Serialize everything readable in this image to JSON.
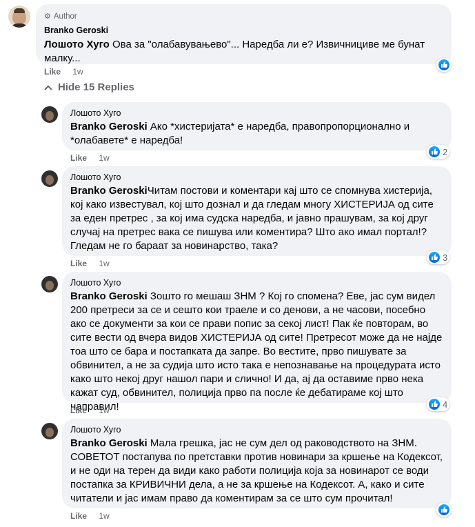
{
  "main_comment": {
    "badge": "Author",
    "name": "Branko Geroski",
    "mention": "Лошото Хуго",
    "text": " Ова за \"олабавувањево\"... Наредба ли е? Извичнициве ме бунат малку...",
    "like": "Like",
    "time": "1w"
  },
  "hide_replies": "Hide 15 Replies",
  "replies": [
    {
      "name": "Лошото Хуго",
      "mention": "Branko Geroski",
      "text": " Ако *хистеријата* е наредба, правопропорционално и *олабавете* е наредба!",
      "like": "Like",
      "time": "1w",
      "reactions": "2"
    },
    {
      "name": "Лошото Хуго",
      "mention": "Branko Geroski",
      "text": "Читам постови и коментари кај што се спомнува хистерија, кој како известувал, кој што дознал и да гледам многу ХИСТЕРИЈА од сите за еден претрес , за кој има судска наредба, и јавно прашувам, за кој друг случај на претрес вака се пишува или коментира? Што ако имал портал!? Гледам не го бараат за новинарство, така?",
      "like": "Like",
      "time": "1w",
      "reactions": "3"
    },
    {
      "name": "Лошото Хуго",
      "mention": "Branko Geroski",
      "text": " Зошто го мешаш ЗНМ ? Кој го спомена? Еве, јас сум видел 200 претреси за се и сешто кои траеле и со денови, а не часови, посебно ако се документи за кои се прави попис за секој лист! Пак ќе повторам, во сите вести од вчера видов ХИСТЕРИЈА од сите! Претресот може да не најде тоа што се бара и постапката да запре. Во вестите, прво пишувате за обвинител, а не за судија што исто така е непознавање на процедурата исто како што некој друг нашол пари и слично! И да, ај да оставиме прво нека кажат суд, обвинител, полиција прво па после ќе дебатираме кој што направил!",
      "like": "Like",
      "time": "1w",
      "reactions": "4"
    },
    {
      "name": "Лошото Хуго",
      "mention": "Branko Geroski",
      "text": " Мала грешка, јас не сум дел од раководството на ЗНМ. СОВЕТОТ постапува по претставки против новинари за кршење на Кодексот, и не оди на терен да види како работи полиција која за новинарот се води постапка за КРИВИЧНИ дела, а не за кршење на Кодексот. А, како и сите читатели и јас имам право да коментирам за се што сум прочитал!",
      "like": "Like",
      "time": "1w",
      "reactions": ""
    }
  ]
}
